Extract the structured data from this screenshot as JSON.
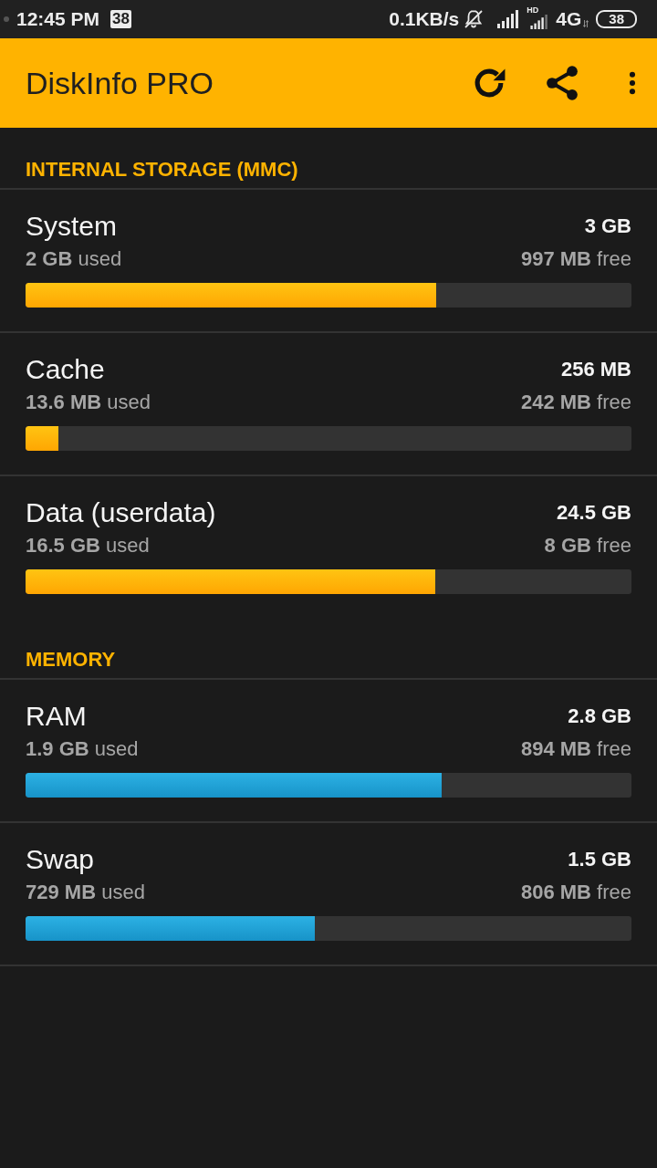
{
  "status_bar": {
    "time": "12:45 PM",
    "notification_badge": "38",
    "network_speed": "0.1KB/s",
    "hd_label": "HD",
    "network_type": "4G",
    "battery": "38"
  },
  "app_bar": {
    "title": "DiskInfo PRO"
  },
  "sections": [
    {
      "title": "INTERNAL STORAGE (MMC)",
      "kind": "storage",
      "items": [
        {
          "name": "System",
          "total": "3 GB",
          "used": "**2 GB** used",
          "free": "**997 MB** free",
          "level": 0.677
        },
        {
          "name": "Cache",
          "total": "256 MB",
          "used": "**13.6 MB** used",
          "free": "**242 MB** free",
          "level": 0.054
        },
        {
          "name": "Data (userdata)",
          "total": "24.5 GB",
          "used": "**16.5 GB** used",
          "free": "**8 GB** free",
          "level": 0.676
        }
      ]
    },
    {
      "title": "MEMORY",
      "kind": "memory",
      "items": [
        {
          "name": "RAM",
          "total": "2.8 GB",
          "used": "**1.9 GB** used",
          "free": "**894 MB** free",
          "level": 0.686
        },
        {
          "name": "Swap",
          "total": "1.5 GB",
          "used": "**729 MB** used",
          "free": "**806 MB** free",
          "level": 0.477
        }
      ]
    }
  ]
}
